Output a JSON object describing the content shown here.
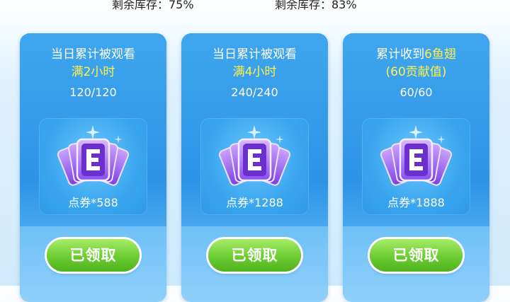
{
  "stock": [
    {
      "label": "剩余库存：75%"
    },
    {
      "label": "剩余库存：83%"
    }
  ],
  "cards": [
    {
      "title_line1": "当日累计被观看",
      "title_line2_plain": "",
      "title_line2_highlight": "满2小时",
      "progress": "120/120",
      "reward": "点券*588",
      "button": "已领取"
    },
    {
      "title_line1": "当日累计被观看",
      "title_line2_plain": "",
      "title_line2_highlight": "满4小时",
      "progress": "240/240",
      "reward": "点券*1288",
      "button": "已领取"
    },
    {
      "title_line1_plain": "累计收到",
      "title_line1_highlight": "6鱼翅",
      "title_line2_highlight": "(60贡献值)",
      "progress": "60/60",
      "reward": "点券*1888",
      "button": "已领取"
    }
  ],
  "icons": {
    "reward": "purple-e-ticket-cards-icon"
  },
  "colors": {
    "card_blue": "#2e93e6",
    "highlight_yellow": "#fff04a",
    "button_green": "#6ccc32"
  }
}
